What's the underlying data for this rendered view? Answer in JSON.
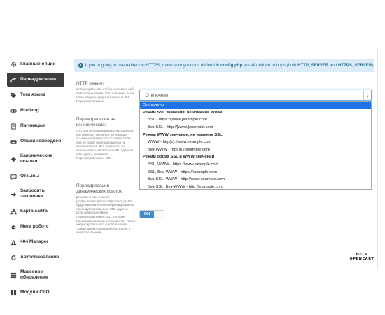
{
  "sidebar": {
    "items": [
      {
        "label": "Главные опции",
        "icon": "gear-icon",
        "active": false
      },
      {
        "label": "Переадресация",
        "icon": "redirect-icon",
        "active": true
      },
      {
        "label": "Теги языка",
        "icon": "tag-icon",
        "active": false
      },
      {
        "label": "Hreflang",
        "icon": "link-icon",
        "active": false
      },
      {
        "label": "Пагинация",
        "icon": "pages-icon",
        "active": false
      },
      {
        "label": "Опции кейвордов",
        "icon": "keyboard-icon",
        "active": false
      },
      {
        "label": "Канонические ссылки",
        "icon": "canonical-icon",
        "active": false
      },
      {
        "label": "Отзывы",
        "icon": "comment-icon",
        "active": false
      },
      {
        "label": "Запросить заголовки",
        "icon": "request-icon",
        "active": false
      },
      {
        "label": "Карта сайта",
        "icon": "sitemap-icon",
        "active": false
      },
      {
        "label": "Мета роботс",
        "icon": "robot-icon",
        "active": false
      },
      {
        "label": "404 Manager",
        "icon": "warning-icon",
        "active": false
      },
      {
        "label": "Автообновление",
        "icon": "refresh-icon",
        "active": false
      },
      {
        "label": "Массовое обновление",
        "icon": "bulk-icon",
        "active": false
      },
      {
        "label": "Модули CEO",
        "icon": "module-icon",
        "active": false
      }
    ]
  },
  "info": {
    "pre": "If you're going to use redirect to HTTPS, make sure your urls defined in ",
    "file": "config.php",
    "mid": " are all defined to https (both ",
    "key1": "HTTP_SERVER",
    "and": " and ",
    "key2": "HTTPS_SERVER",
    "end": ")."
  },
  "settings": {
    "https": {
      "title": "HTTP режим:",
      "text": "Используйте это, чтобы заставить веб-сайт использовать SSL или www, если URL неверен, будет выполнено 301 Перенаправление."
    },
    "canonical": {
      "title": "Переадресация на канонические:",
      "text": "Это для дублированных URL-адресов, он проверит, является ли текущая ссылка канонической ссылкой, если она не будет перенаправлена на каноническую. Это позволяет не использовать несколько URL-адресов для одного элемента. Перенаправление - 301."
    },
    "dynamic": {
      "title": "Переадресация динамических ссылок:",
      "text": "Динамические ссылки (route=product/product&product_id=50) будут автоматически перенаправлены на их дублированные URL-адреса, если они существуют. Перенаправление - 301, поэтому поисковая система остановится, чтобы индексировать его и использовать только дружественный URL-адрес в качестве ссылки."
    }
  },
  "select": {
    "value": "Отключено",
    "options": [
      {
        "label": "Отключено",
        "kind": "selected"
      },
      {
        "label": "Режим SSL значения, не изменяя WWW",
        "kind": "group"
      },
      {
        "label": "SSL - https://[www.]example.com",
        "kind": "child"
      },
      {
        "label": "Без-SSL - http://[www.]example.com",
        "kind": "child"
      },
      {
        "label": "Режим WWW значения, не изменяя SSL",
        "kind": "group"
      },
      {
        "label": "WWW - http(s)://www.example.com",
        "kind": "child"
      },
      {
        "label": "Без-WWW - http(s)://example.com",
        "kind": "child"
      },
      {
        "label": "Режим обоих SSL и WWW значений",
        "kind": "group"
      },
      {
        "label": "SSL, WWW - https://www.example.com",
        "kind": "child"
      },
      {
        "label": "SSL, Без-WWW - https://example.com",
        "kind": "child"
      },
      {
        "label": "Без-SSL, WWW - http://www.example.com",
        "kind": "child"
      },
      {
        "label": "Без-SSL, Без-WWW - http://example.com",
        "kind": "child"
      }
    ]
  },
  "toggle": {
    "on_label": "ON"
  },
  "watermark": {
    "line1": "HELP",
    "line2": "OPENCART"
  },
  "colors": {
    "active_bg": "#3d3d3d",
    "info_bg": "#d9ecf7",
    "selected_option": "#1e73e8",
    "toggle_on": "#428bca"
  }
}
